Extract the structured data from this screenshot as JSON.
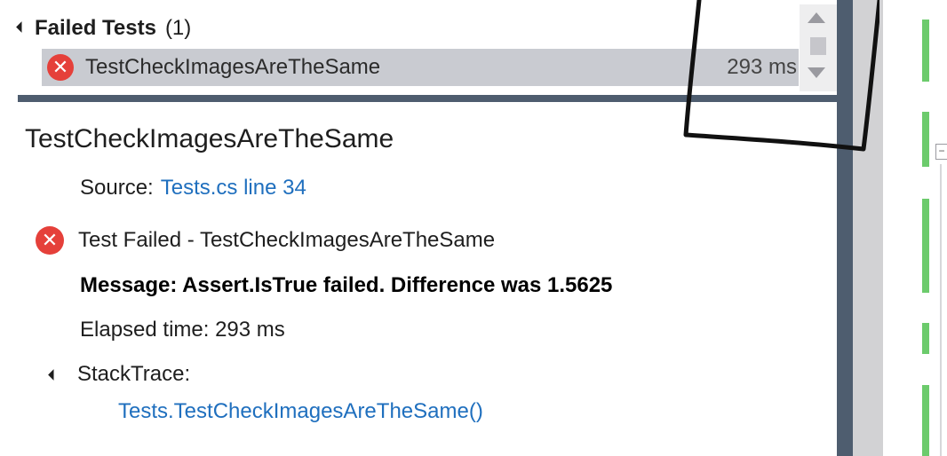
{
  "test_list": {
    "group_title": "Failed Tests",
    "group_count": "(1)",
    "rows": [
      {
        "name": "TestCheckImagesAreTheSame",
        "duration": "293 ms",
        "status_icon": "error-icon"
      }
    ]
  },
  "details": {
    "title": "TestCheckImagesAreTheSame",
    "source_label": "Source:",
    "source_link": "Tests.cs line 34",
    "status_text": "Test Failed - TestCheckImagesAreTheSame",
    "message": "Message: Assert.IsTrue failed. Difference was 1.5625",
    "elapsed": "Elapsed time: 293 ms",
    "stacktrace_label": "StackTrace:",
    "stacktrace_link": "Tests.TestCheckImagesAreTheSame()"
  },
  "icons": {
    "error_glyph": "✕",
    "collapse_glyph": "−"
  },
  "colors": {
    "error_red": "#e5403a",
    "link_blue": "#1f6fbe",
    "selection_gray": "#c9cbd1",
    "splitter": "#4e5d6f",
    "coverage_green": "#6ccb6c"
  }
}
